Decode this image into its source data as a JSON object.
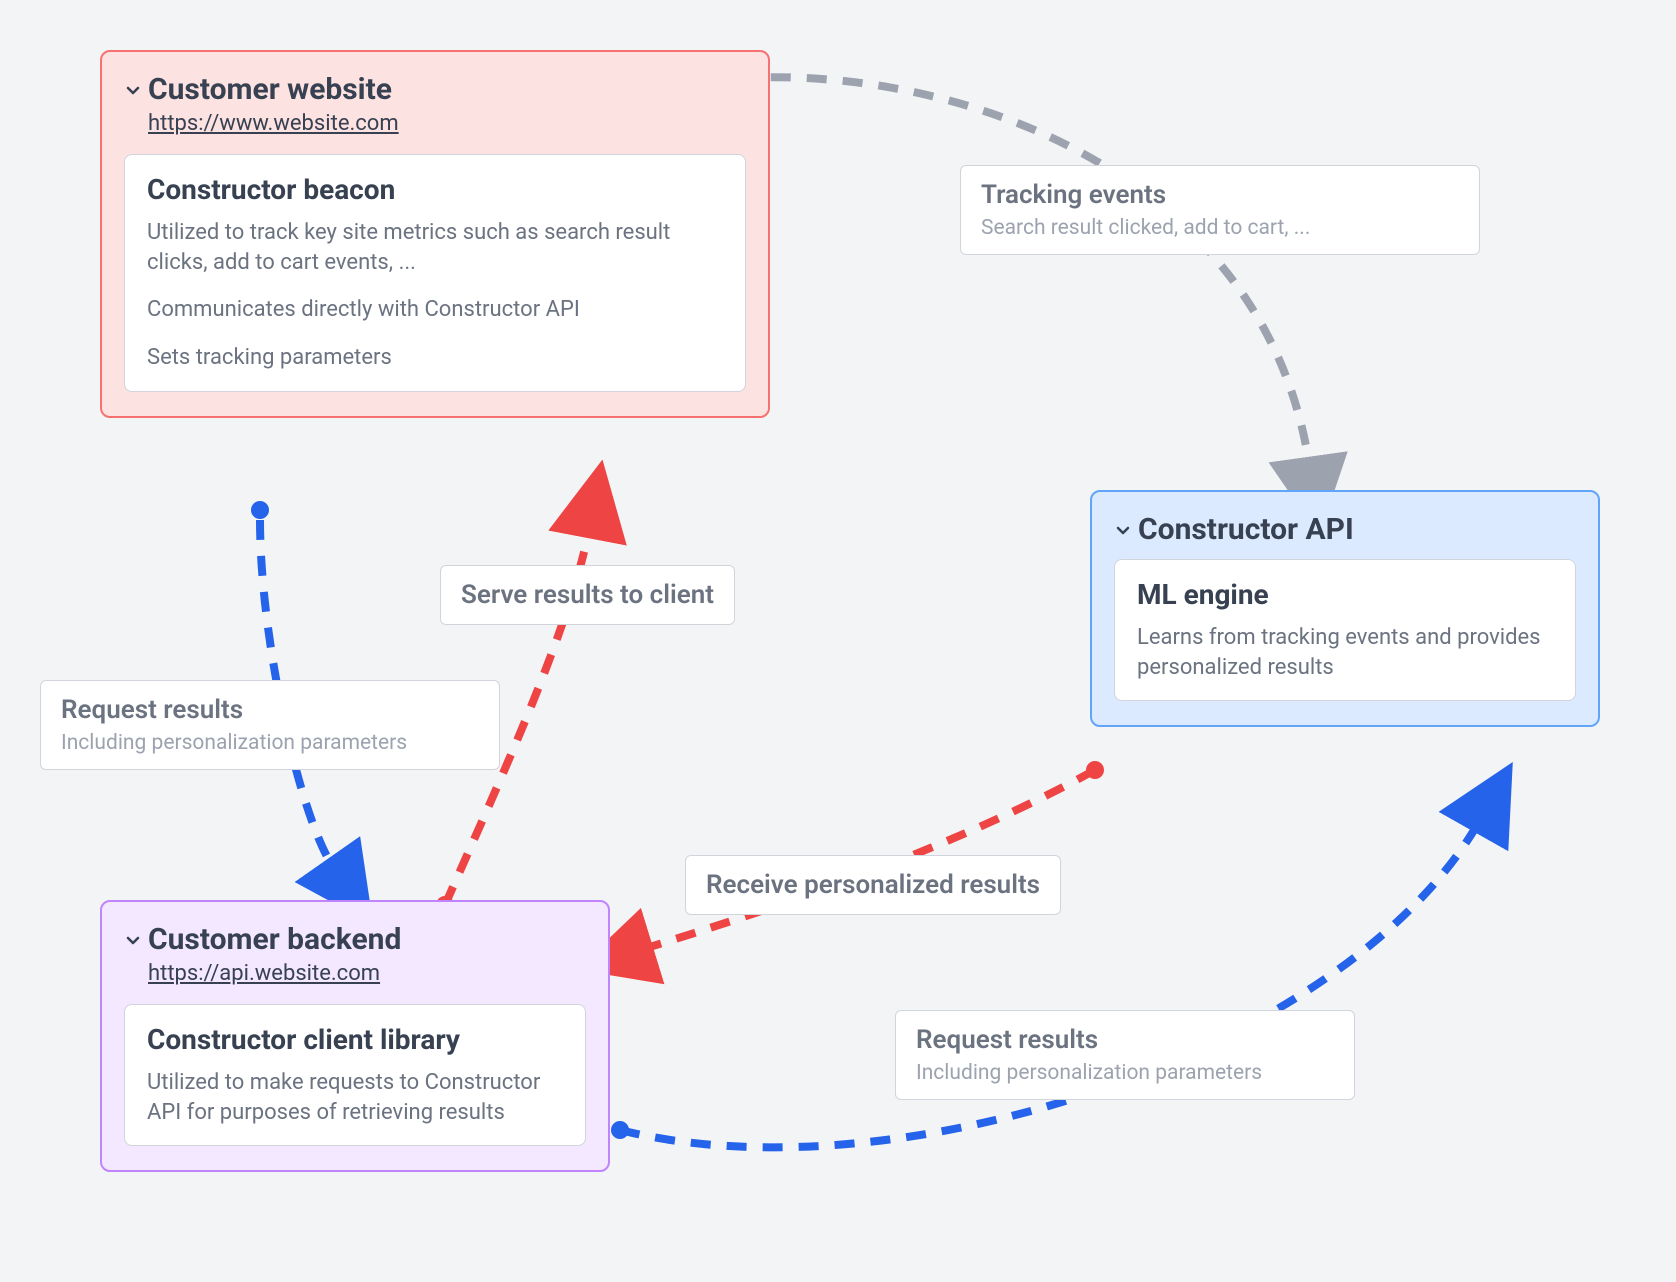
{
  "nodes": {
    "website": {
      "title": "Customer website",
      "subtitle": "https://www.website.com",
      "card": {
        "title": "Constructor beacon",
        "p1": "Utilized to track key site metrics such as search result clicks, add to cart events, ...",
        "p2": "Communicates directly with Constructor API",
        "p3": "Sets tracking parameters"
      }
    },
    "api": {
      "title": "Constructor API",
      "card": {
        "title": "ML engine",
        "body": "Learns from tracking events and provides personalized results"
      }
    },
    "backend": {
      "title": "Customer backend",
      "subtitle": "https://api.website.com",
      "card": {
        "title": "Constructor client library",
        "body": "Utilized to make requests to Constructor API for purposes of retrieving results"
      }
    }
  },
  "edges": {
    "tracking": {
      "title": "Tracking events",
      "sub": "Search result clicked, add to cart, ..."
    },
    "serve": {
      "title": "Serve results to client"
    },
    "req1": {
      "title": "Request results",
      "sub": "Including personalization parameters"
    },
    "recv": {
      "title": "Receive personalized results"
    },
    "req2": {
      "title": "Request results",
      "sub": "Including personalization parameters"
    }
  },
  "colors": {
    "gray": "#9ca3af",
    "blue": "#2563eb",
    "red": "#ef4444"
  }
}
